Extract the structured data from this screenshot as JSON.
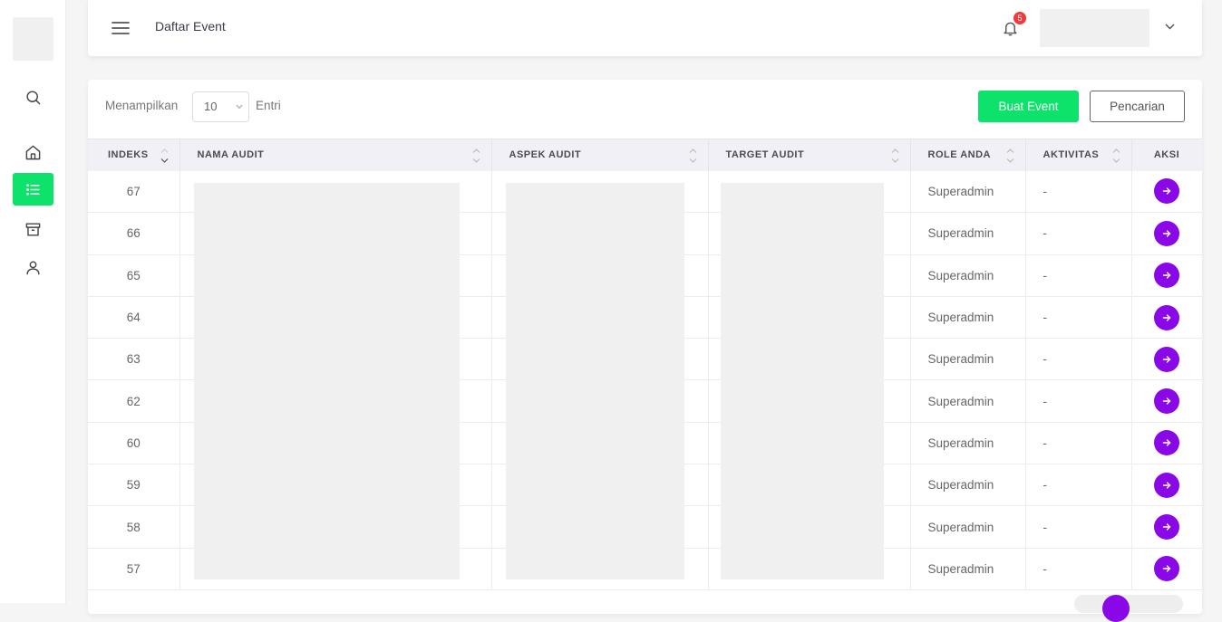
{
  "header": {
    "title": "Daftar Event",
    "notification_count": "5"
  },
  "toolbar": {
    "show_label": "Menampilkan",
    "entries_value": "10",
    "entries_label": "Entri",
    "create_label": "Buat Event",
    "search_label": "Pencarian"
  },
  "table": {
    "columns": [
      "INDEKS",
      "NAMA AUDIT",
      "ASPEK AUDIT",
      "TARGET AUDIT",
      "ROLE ANDA",
      "AKTIVITAS",
      "AKSI"
    ],
    "rows": [
      {
        "index": "67",
        "role": "Superadmin",
        "activity": "-"
      },
      {
        "index": "66",
        "role": "Superadmin",
        "activity": "-"
      },
      {
        "index": "65",
        "role": "Superadmin",
        "activity": "-"
      },
      {
        "index": "64",
        "role": "Superadmin",
        "activity": "-"
      },
      {
        "index": "63",
        "role": "Superadmin",
        "activity": "-"
      },
      {
        "index": "62",
        "role": "Superadmin",
        "activity": "-"
      },
      {
        "index": "60",
        "role": "Superadmin",
        "activity": "-"
      },
      {
        "index": "59",
        "role": "Superadmin",
        "activity": "-"
      },
      {
        "index": "58",
        "role": "Superadmin",
        "activity": "-"
      },
      {
        "index": "57",
        "role": "Superadmin",
        "activity": "-"
      }
    ]
  },
  "colors": {
    "accent_green": "#0de36a",
    "action_purple": "#8a08e8",
    "badge_red": "#ef3b3b"
  },
  "icons": {
    "sidebar": [
      "search-icon",
      "home-icon",
      "list-icon",
      "archive-icon",
      "user-icon"
    ],
    "header": [
      "hamburger-menu-icon",
      "bell-icon",
      "chevron-down-icon"
    ],
    "row_action": "arrow-right-icon"
  }
}
